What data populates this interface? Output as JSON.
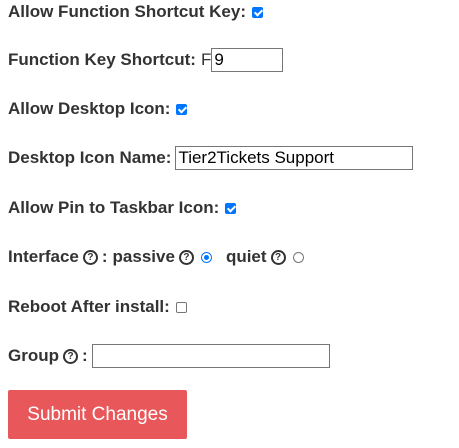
{
  "form": {
    "allow_function_shortcut": {
      "label": "Allow Function Shortcut Key:",
      "checked": true
    },
    "function_key_shortcut": {
      "label": "Function Key Shortcut:",
      "prefix": "F",
      "value": "9"
    },
    "allow_desktop_icon": {
      "label": "Allow Desktop Icon:",
      "checked": true
    },
    "desktop_icon_name": {
      "label": "Desktop Icon Name:",
      "value": "Tier2Tickets Support"
    },
    "allow_pin_taskbar": {
      "label": "Allow Pin to Taskbar Icon:",
      "checked": true
    },
    "interface": {
      "label": "Interface",
      "colon": ":",
      "options": [
        {
          "label": "passive",
          "selected": true
        },
        {
          "label": "quiet",
          "selected": false
        }
      ]
    },
    "reboot_after_install": {
      "label": "Reboot After install:",
      "checked": false
    },
    "group": {
      "label": "Group",
      "colon": ":",
      "value": ""
    },
    "help_glyph": "?",
    "submit_label": "Submit Changes"
  },
  "colors": {
    "accent": "#0075ff",
    "submit_bg": "#e8575a",
    "text": "#333333"
  }
}
